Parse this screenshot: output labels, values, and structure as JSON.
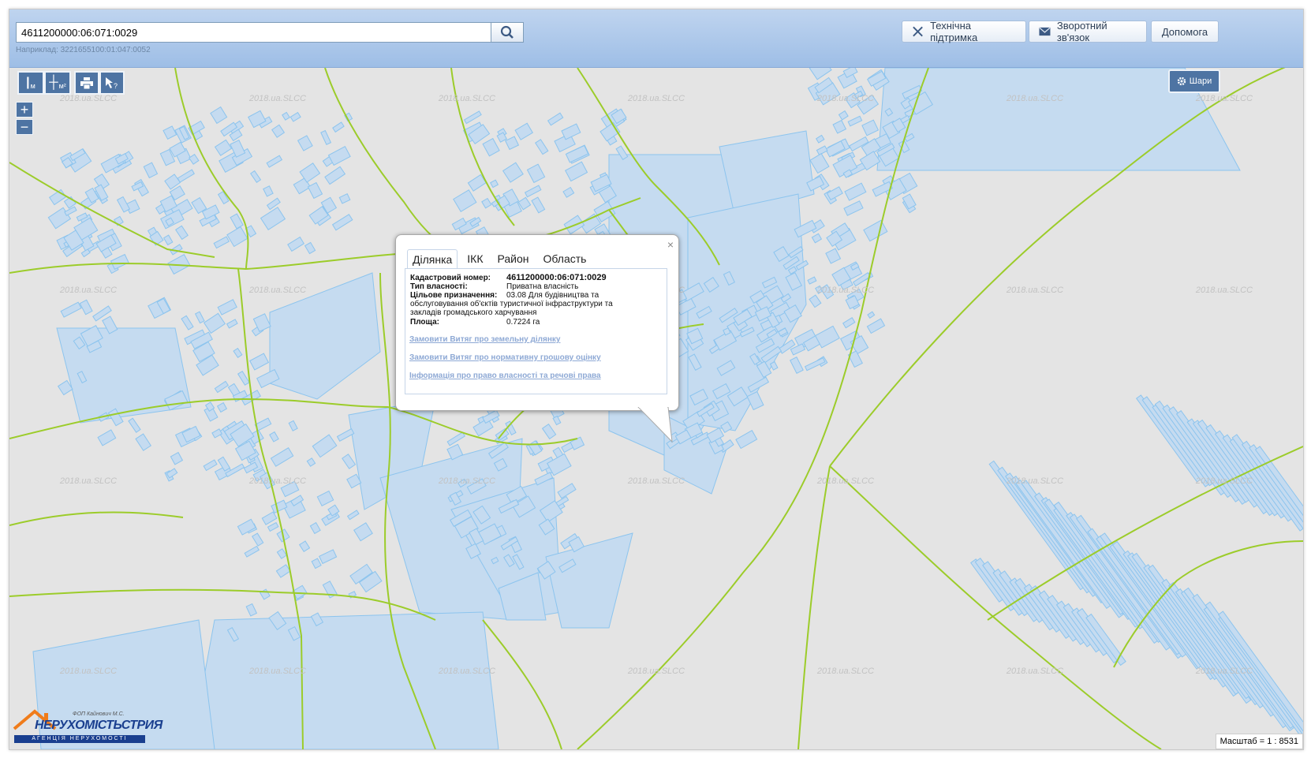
{
  "search": {
    "value": "4611200000:06:071:0029",
    "example": "Наприклад: 3221655100:01:047:0052"
  },
  "header_buttons": {
    "support": "Технічна підтримка",
    "feedback": "Зворотний зв'язок",
    "help": "Допомога"
  },
  "toolbar": {
    "measure_length": "м",
    "measure_area": "м²",
    "zoom_in": "+",
    "zoom_out": "−",
    "layers": "Шари"
  },
  "popup": {
    "tabs": [
      "Ділянка",
      "ІКК",
      "Район",
      "Область"
    ],
    "active_tab": "Ділянка",
    "fields": [
      {
        "label": "Кадастровий номер:",
        "value": "4611200000:06:071:0029"
      },
      {
        "label": "Тип власності:",
        "value": "Приватна власність"
      },
      {
        "label": "Цільове призначення:",
        "value": "03.08 Для будівництва та обслуговування об'єктів туристичної інфраструктури та закладів громадського харчування"
      },
      {
        "label": "Площа:",
        "value": "0.7224 га"
      }
    ],
    "links": [
      "Замовити Витяг про земельну ділянку",
      "Замовити Витяг про нормативну грошову оцінку",
      "Інформація про право власності та речові права"
    ],
    "close": "×"
  },
  "watermark": "2018.ua.SLCC",
  "logo": {
    "name": "НЕРУХОМІСТЬСТРИЯ",
    "sub": "АГЕНЦІЯ НЕРУХОМОСТІ",
    "owner": "ФОП Кайнович М.С."
  },
  "scale": "Масштаб = 1 : 8531",
  "colors": {
    "header": "#a9c6ec",
    "map_bg": "#e4e4e4",
    "parcel_fill": "#c5dbf0",
    "parcel_stroke": "#8cc4ee",
    "boundary": "#9ccc2a",
    "button": "#4e74a3"
  }
}
